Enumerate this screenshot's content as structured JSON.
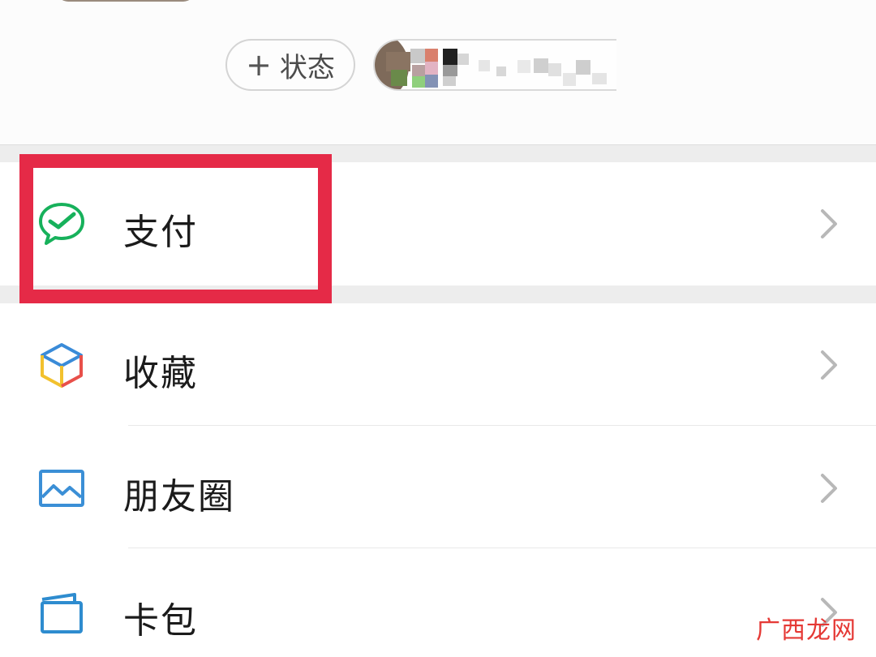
{
  "profile": {
    "status_button_label": "状态",
    "status_button_icon": "plus-icon"
  },
  "menu": {
    "items": [
      {
        "label": "支付",
        "icon": "wechat-pay-icon"
      },
      {
        "label": "收藏",
        "icon": "favorites-cube-icon"
      },
      {
        "label": "朋友圈",
        "icon": "moments-picture-icon"
      },
      {
        "label": "卡包",
        "icon": "card-wallet-icon"
      }
    ]
  },
  "highlight": {
    "color": "#e52a47",
    "target": "支付"
  },
  "watermark": {
    "text": "广西龙网"
  },
  "colors": {
    "pay_green": "#17b15b",
    "chevron_gray": "#b8b8b8",
    "separator": "#ededed",
    "moments_blue": "#3b8fd6",
    "card_blue": "#2e8ccf"
  }
}
